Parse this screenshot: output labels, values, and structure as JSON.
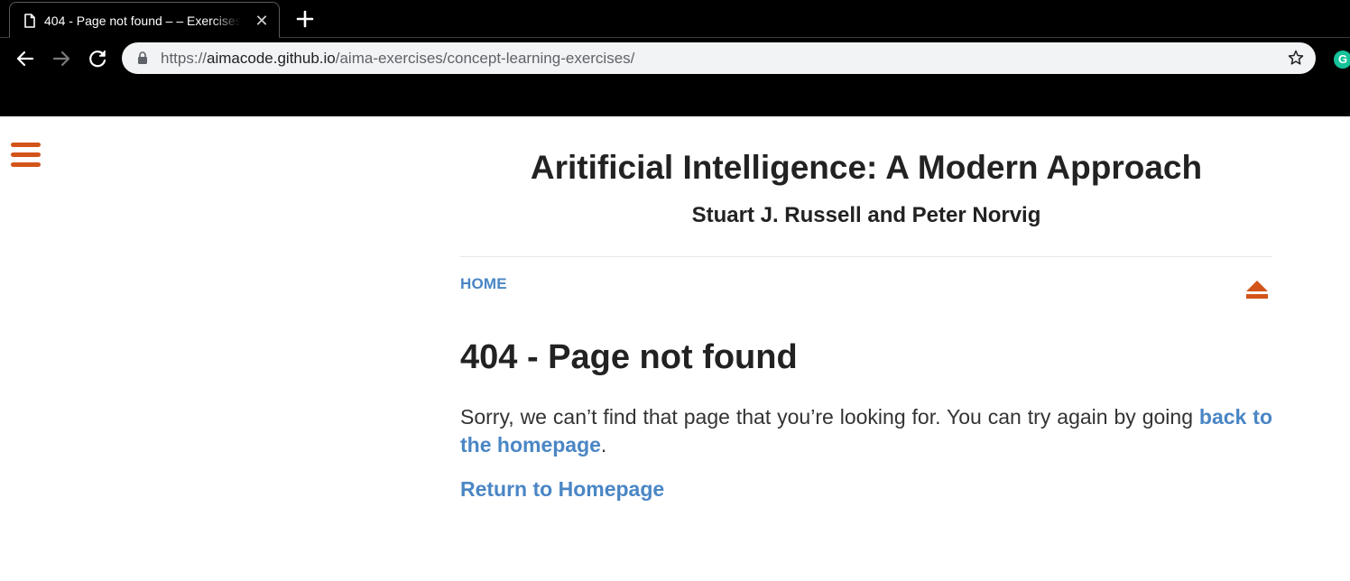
{
  "browser": {
    "tab": {
      "title": "404 - Page not found – – Exercises",
      "close_glyph": "✕",
      "icon": "document-icon"
    },
    "new_tab_icon": "plus-icon",
    "nav": {
      "back_icon": "arrow-left-icon",
      "forward_icon": "arrow-right-icon",
      "reload_icon": "reload-icon"
    },
    "omnibox": {
      "scheme": "https://",
      "host": "aimacode.github.io",
      "path": "/aima-exercises/concept-learning-exercises/",
      "lock_icon": "lock-icon",
      "bookmark_icon": "star-icon"
    },
    "extension": {
      "label": "G",
      "color": "#15c39a"
    }
  },
  "page": {
    "menu_icon": "hamburger-menu-icon",
    "site_title": "Aritificial Intelligence: A Modern Approach",
    "site_authors": "Stuart J. Russell and Peter Norvig",
    "nav_home": "HOME",
    "top_icon": "eject-up-icon",
    "error_title": "404 - Page not found",
    "error_text_before": "Sorry, we can’t find that page that you’re looking for. You can try again by going ",
    "error_text_link": "back to the homepage",
    "error_text_after": ".",
    "return_link": "Return to Homepage"
  },
  "colors": {
    "accent_orange": "#d35419",
    "link_blue": "#4a86c5",
    "text_dark": "#222222",
    "chrome_bg": "#000000",
    "omnibox_bg": "#f1f3f4"
  }
}
